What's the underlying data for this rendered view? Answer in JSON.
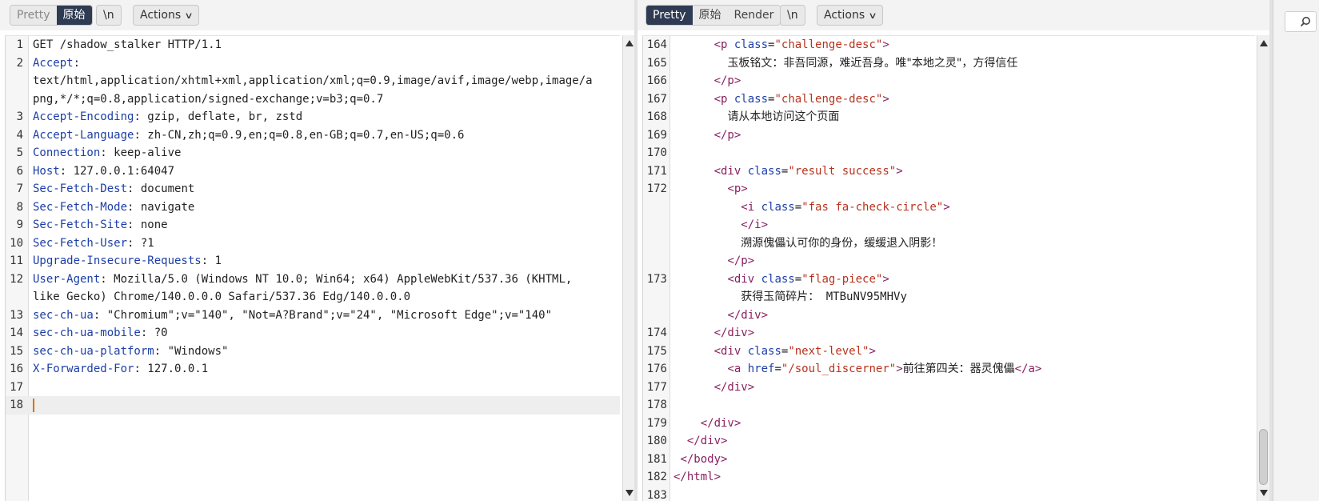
{
  "request": {
    "tabs": [
      {
        "label": "Pretty",
        "active": false,
        "dim": true
      },
      {
        "label": "原始",
        "active": true
      }
    ],
    "newline_label": "\\n",
    "actions_label": "Actions",
    "lines": [
      {
        "n": "1",
        "parts": [
          {
            "c": "tx",
            "t": "GET /shadow_stalker HTTP/1.1"
          }
        ]
      },
      {
        "n": "2",
        "parts": [
          {
            "c": "hn",
            "t": "Accept"
          },
          {
            "c": "tx",
            "t": ":"
          }
        ]
      },
      {
        "n": "",
        "parts": [
          {
            "c": "tx",
            "t": "text/html,application/xhtml+xml,application/xml;q=0.9,image/avif,image/webp,image/a"
          }
        ]
      },
      {
        "n": "",
        "parts": [
          {
            "c": "tx",
            "t": "png,*/*;q=0.8,application/signed-exchange;v=b3;q=0.7"
          }
        ]
      },
      {
        "n": "3",
        "parts": [
          {
            "c": "hn",
            "t": "Accept-Encoding"
          },
          {
            "c": "tx",
            "t": ": gzip, deflate, br, zstd"
          }
        ]
      },
      {
        "n": "4",
        "parts": [
          {
            "c": "hn",
            "t": "Accept-Language"
          },
          {
            "c": "tx",
            "t": ": zh-CN,zh;q=0.9,en;q=0.8,en-GB;q=0.7,en-US;q=0.6"
          }
        ]
      },
      {
        "n": "5",
        "parts": [
          {
            "c": "hn",
            "t": "Connection"
          },
          {
            "c": "tx",
            "t": ": keep-alive"
          }
        ]
      },
      {
        "n": "6",
        "parts": [
          {
            "c": "hn",
            "t": "Host"
          },
          {
            "c": "tx",
            "t": ": 127.0.0.1:64047"
          }
        ]
      },
      {
        "n": "7",
        "parts": [
          {
            "c": "hn",
            "t": "Sec-Fetch-Dest"
          },
          {
            "c": "tx",
            "t": ": document"
          }
        ]
      },
      {
        "n": "8",
        "parts": [
          {
            "c": "hn",
            "t": "Sec-Fetch-Mode"
          },
          {
            "c": "tx",
            "t": ": navigate"
          }
        ]
      },
      {
        "n": "9",
        "parts": [
          {
            "c": "hn",
            "t": "Sec-Fetch-Site"
          },
          {
            "c": "tx",
            "t": ": none"
          }
        ]
      },
      {
        "n": "10",
        "parts": [
          {
            "c": "hn",
            "t": "Sec-Fetch-User"
          },
          {
            "c": "tx",
            "t": ": ?1"
          }
        ]
      },
      {
        "n": "11",
        "parts": [
          {
            "c": "hn",
            "t": "Upgrade-Insecure-Requests"
          },
          {
            "c": "tx",
            "t": ": 1"
          }
        ]
      },
      {
        "n": "12",
        "parts": [
          {
            "c": "hn",
            "t": "User-Agent"
          },
          {
            "c": "tx",
            "t": ": Mozilla/5.0 (Windows NT 10.0; Win64; x64) AppleWebKit/537.36 (KHTML,"
          }
        ]
      },
      {
        "n": "",
        "parts": [
          {
            "c": "tx",
            "t": "like Gecko) Chrome/140.0.0.0 Safari/537.36 Edg/140.0.0.0"
          }
        ]
      },
      {
        "n": "13",
        "parts": [
          {
            "c": "hn",
            "t": "sec-ch-ua"
          },
          {
            "c": "tx",
            "t": ": \"Chromium\";v=\"140\", \"Not=A?Brand\";v=\"24\", \"Microsoft Edge\";v=\"140\""
          }
        ]
      },
      {
        "n": "14",
        "parts": [
          {
            "c": "hn",
            "t": "sec-ch-ua-mobile"
          },
          {
            "c": "tx",
            "t": ": ?0"
          }
        ]
      },
      {
        "n": "15",
        "parts": [
          {
            "c": "hn",
            "t": "sec-ch-ua-platform"
          },
          {
            "c": "tx",
            "t": ": \"Windows\""
          }
        ]
      },
      {
        "n": "16",
        "parts": [
          {
            "c": "hn",
            "t": "X-Forwarded-For"
          },
          {
            "c": "tx",
            "t": ": 127.0.0.1"
          }
        ]
      },
      {
        "n": "17",
        "parts": []
      },
      {
        "n": "18",
        "parts": [],
        "cursor": true
      }
    ]
  },
  "response": {
    "tabs": [
      {
        "label": "Pretty",
        "active": true
      },
      {
        "label": "原始",
        "active": false
      },
      {
        "label": "Render",
        "active": false
      }
    ],
    "newline_label": "\\n",
    "actions_label": "Actions",
    "lines": [
      {
        "n": "164",
        "parts": [
          {
            "c": "tx",
            "t": "      "
          },
          {
            "c": "tg",
            "t": "<p "
          },
          {
            "c": "at",
            "t": "class"
          },
          {
            "c": "tx",
            "t": "="
          },
          {
            "c": "av",
            "t": "\"challenge-desc\""
          },
          {
            "c": "tg",
            "t": ">"
          }
        ]
      },
      {
        "n": "165",
        "parts": [
          {
            "c": "tx",
            "t": "        "
          },
          {
            "c": "tx cjk",
            "t": "玉板铭文：非吾同源，难近吾身。唯\"本地之灵\"，方得信任"
          }
        ]
      },
      {
        "n": "166",
        "parts": [
          {
            "c": "tx",
            "t": "      "
          },
          {
            "c": "tg",
            "t": "</p>"
          }
        ]
      },
      {
        "n": "167",
        "parts": [
          {
            "c": "tx",
            "t": "      "
          },
          {
            "c": "tg",
            "t": "<p "
          },
          {
            "c": "at",
            "t": "class"
          },
          {
            "c": "tx",
            "t": "="
          },
          {
            "c": "av",
            "t": "\"challenge-desc\""
          },
          {
            "c": "tg",
            "t": ">"
          }
        ]
      },
      {
        "n": "168",
        "parts": [
          {
            "c": "tx",
            "t": "        "
          },
          {
            "c": "tx cjk",
            "t": "请从本地访问这个页面"
          }
        ]
      },
      {
        "n": "169",
        "parts": [
          {
            "c": "tx",
            "t": "      "
          },
          {
            "c": "tg",
            "t": "</p>"
          }
        ]
      },
      {
        "n": "170",
        "parts": []
      },
      {
        "n": "171",
        "parts": [
          {
            "c": "tx",
            "t": "      "
          },
          {
            "c": "tg",
            "t": "<div "
          },
          {
            "c": "at",
            "t": "class"
          },
          {
            "c": "tx",
            "t": "="
          },
          {
            "c": "av",
            "t": "\"result success\""
          },
          {
            "c": "tg",
            "t": ">"
          }
        ]
      },
      {
        "n": "172",
        "parts": [
          {
            "c": "tx",
            "t": "        "
          },
          {
            "c": "tg",
            "t": "<p>"
          }
        ]
      },
      {
        "n": "",
        "parts": [
          {
            "c": "tx",
            "t": "          "
          },
          {
            "c": "tg",
            "t": "<i "
          },
          {
            "c": "at",
            "t": "class"
          },
          {
            "c": "tx",
            "t": "="
          },
          {
            "c": "av",
            "t": "\"fas fa-check-circle\""
          },
          {
            "c": "tg",
            "t": ">"
          }
        ]
      },
      {
        "n": "",
        "parts": [
          {
            "c": "tx",
            "t": "          "
          },
          {
            "c": "tg",
            "t": "</i>"
          }
        ]
      },
      {
        "n": "",
        "parts": [
          {
            "c": "tx",
            "t": "          "
          },
          {
            "c": "tx cjk",
            "t": "溯源傀儡认可你的身份，缓缓退入阴影！"
          }
        ]
      },
      {
        "n": "",
        "parts": [
          {
            "c": "tx",
            "t": "        "
          },
          {
            "c": "tg",
            "t": "</p>"
          }
        ]
      },
      {
        "n": "173",
        "parts": [
          {
            "c": "tx",
            "t": "        "
          },
          {
            "c": "tg",
            "t": "<div "
          },
          {
            "c": "at",
            "t": "class"
          },
          {
            "c": "tx",
            "t": "="
          },
          {
            "c": "av",
            "t": "\"flag-piece\""
          },
          {
            "c": "tg",
            "t": ">"
          }
        ]
      },
      {
        "n": "",
        "parts": [
          {
            "c": "tx",
            "t": "          "
          },
          {
            "c": "tx cjk",
            "t": "获得玉简碎片："
          },
          {
            "c": "tx",
            "t": " MTBuNV95MHVy"
          }
        ]
      },
      {
        "n": "",
        "parts": [
          {
            "c": "tx",
            "t": "        "
          },
          {
            "c": "tg",
            "t": "</div>"
          }
        ]
      },
      {
        "n": "174",
        "parts": [
          {
            "c": "tx",
            "t": "      "
          },
          {
            "c": "tg",
            "t": "</div>"
          }
        ]
      },
      {
        "n": "175",
        "parts": [
          {
            "c": "tx",
            "t": "      "
          },
          {
            "c": "tg",
            "t": "<div "
          },
          {
            "c": "at",
            "t": "class"
          },
          {
            "c": "tx",
            "t": "="
          },
          {
            "c": "av",
            "t": "\"next-level\""
          },
          {
            "c": "tg",
            "t": ">"
          }
        ]
      },
      {
        "n": "176",
        "parts": [
          {
            "c": "tx",
            "t": "        "
          },
          {
            "c": "tg",
            "t": "<a "
          },
          {
            "c": "at",
            "t": "href"
          },
          {
            "c": "tx",
            "t": "="
          },
          {
            "c": "av",
            "t": "\"/soul_discerner\""
          },
          {
            "c": "tg",
            "t": ">"
          },
          {
            "c": "tx cjk",
            "t": "前往第四关：器灵傀儡"
          },
          {
            "c": "tg",
            "t": "</a>"
          }
        ]
      },
      {
        "n": "177",
        "parts": [
          {
            "c": "tx",
            "t": "      "
          },
          {
            "c": "tg",
            "t": "</div>"
          }
        ]
      },
      {
        "n": "178",
        "parts": []
      },
      {
        "n": "179",
        "parts": [
          {
            "c": "tx",
            "t": "    "
          },
          {
            "c": "tg",
            "t": "</div>"
          }
        ]
      },
      {
        "n": "180",
        "parts": [
          {
            "c": "tx",
            "t": "  "
          },
          {
            "c": "tg",
            "t": "</div>"
          }
        ]
      },
      {
        "n": "181",
        "parts": [
          {
            "c": "tx",
            "t": " "
          },
          {
            "c": "tg",
            "t": "</body>"
          }
        ]
      },
      {
        "n": "182",
        "parts": [
          {
            "c": "tg",
            "t": "</html>"
          }
        ]
      },
      {
        "n": "183",
        "parts": []
      }
    ]
  },
  "icons": {
    "actions_chevron": "chevron-down-icon",
    "scroll_up": "arrow-up-icon",
    "scroll_down": "arrow-down-icon",
    "search": "search-icon"
  }
}
